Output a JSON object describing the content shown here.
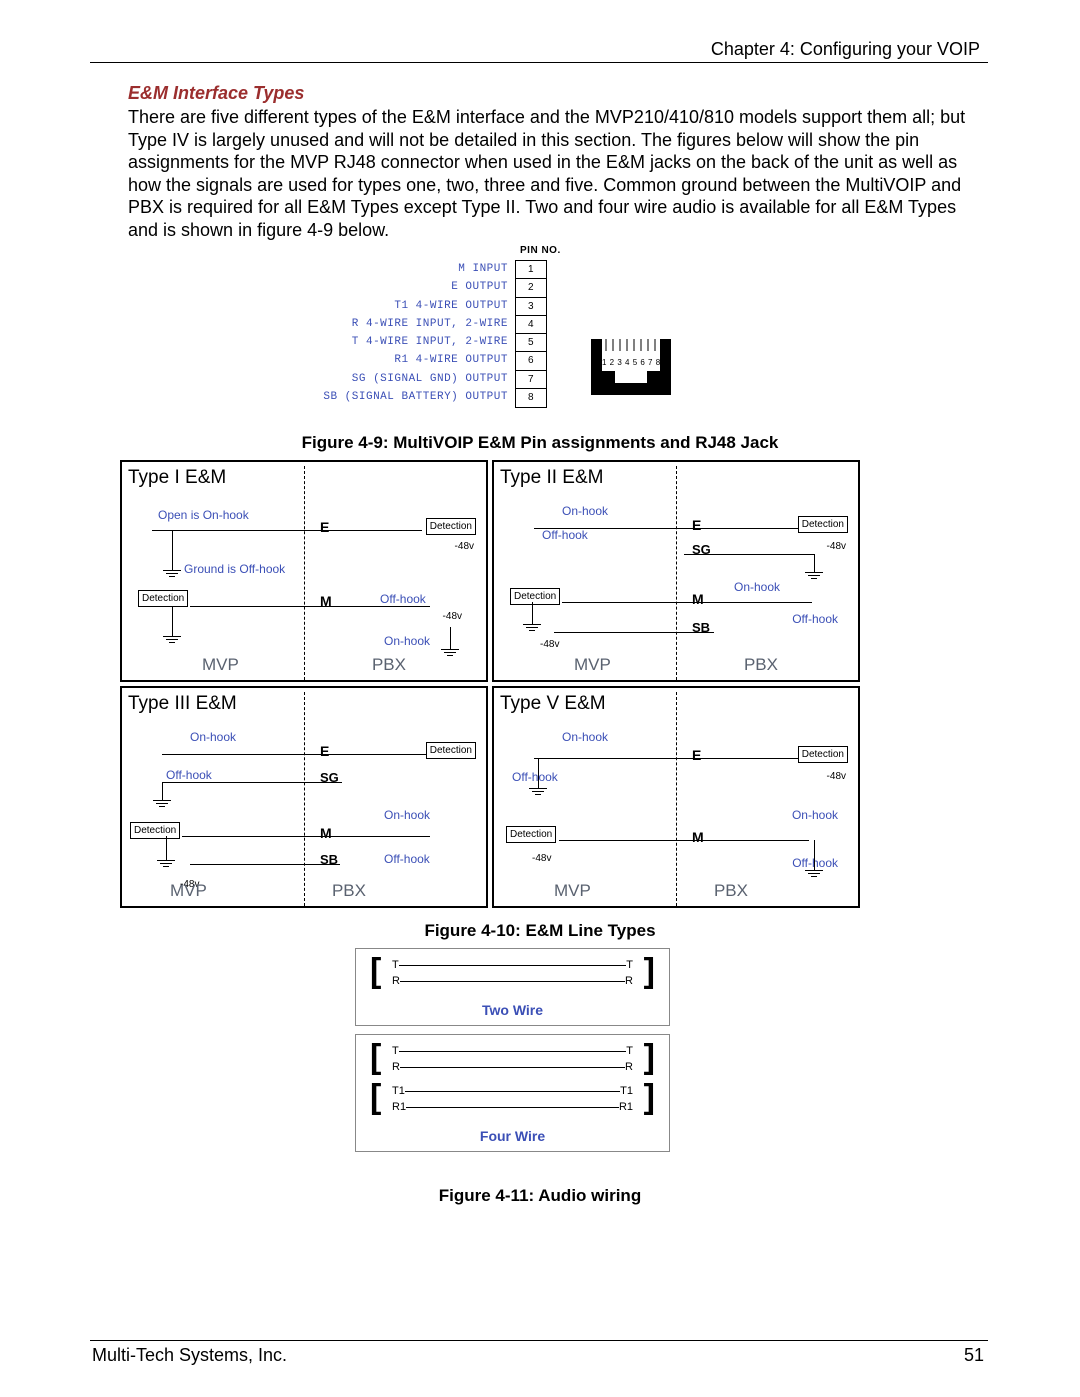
{
  "header": {
    "chapter": "Chapter 4: Configuring your VOIP"
  },
  "section_heading": "E&M Interface Types",
  "body": "There are five different types of the E&M interface and the MVP210/410/810 models support them all; but Type IV is largely unused and will not be detailed in this section. The figures below will show the pin assignments for the MVP RJ48 connector when used in the E&M jacks on the back of the unit as well as how the signals are used for types one, two, three and five. Common ground between the MultiVOIP and PBX is required for all E&M Types except Type II. Two and four wire audio is available for all E&M Types and is shown in figure 4-9 below.",
  "captions": {
    "fig9": "Figure 4-9: MultiVOIP E&M Pin assignments and RJ48 Jack",
    "fig10": "Figure 4-10: E&M Line Types",
    "fig11": "Figure 4-11: Audio wiring"
  },
  "fig9": {
    "pin_header": "PIN NO.",
    "pins": [
      {
        "label": "M  INPUT",
        "num": "1"
      },
      {
        "label": "E  OUTPUT",
        "num": "2"
      },
      {
        "label": "T1  4-WIRE OUTPUT",
        "num": "3"
      },
      {
        "label": "R  4-WIRE INPUT, 2-WIRE",
        "num": "4"
      },
      {
        "label": "T  4-WIRE INPUT, 2-WIRE",
        "num": "5"
      },
      {
        "label": "R1  4-WIRE OUTPUT",
        "num": "6"
      },
      {
        "label": "SG  (SIGNAL GND) OUTPUT",
        "num": "7"
      },
      {
        "label": "SB  (SIGNAL BATTERY) OUTPUT",
        "num": "8"
      }
    ],
    "jack_nums": "1 2 3 4 5 6 7 8"
  },
  "fig10": {
    "panels": [
      {
        "title": "Type I E&M",
        "mvp": "MVP",
        "pbx": "PBX",
        "labels": {
          "open": "Open is On-hook",
          "gnd": "Ground is Off-hook",
          "det": "Detection",
          "E": "E",
          "M": "M",
          "onhook": "On-hook",
          "offhook": "Off-hook",
          "m48": "-48v"
        }
      },
      {
        "title": "Type II E&M",
        "mvp": "MVP",
        "pbx": "PBX",
        "labels": {
          "onhook": "On-hook",
          "offhook": "Off-hook",
          "det": "Detection",
          "E": "E",
          "SG": "SG",
          "M": "M",
          "SB": "SB",
          "m48": "-48v"
        }
      },
      {
        "title": "Type III E&M",
        "mvp": "MVP",
        "pbx": "PBX",
        "labels": {
          "onhook": "On-hook",
          "offhook": "Off-hook",
          "det": "Detection",
          "E": "E",
          "SG": "SG",
          "M": "M",
          "SB": "SB",
          "m48": "-48v"
        }
      },
      {
        "title": "Type V E&M",
        "mvp": "MVP",
        "pbx": "PBX",
        "labels": {
          "onhook": "On-hook",
          "offhook": "Off-hook",
          "det": "Detection",
          "E": "E",
          "M": "M",
          "m48": "-48v"
        }
      }
    ]
  },
  "fig11": {
    "two": {
      "caption": "Two Wire",
      "T": "T",
      "R": "R"
    },
    "four": {
      "caption": "Four Wire",
      "T": "T",
      "R": "R",
      "T1": "T1",
      "R1": "R1"
    }
  },
  "footer": {
    "company": "Multi-Tech Systems, Inc.",
    "page": "51"
  }
}
